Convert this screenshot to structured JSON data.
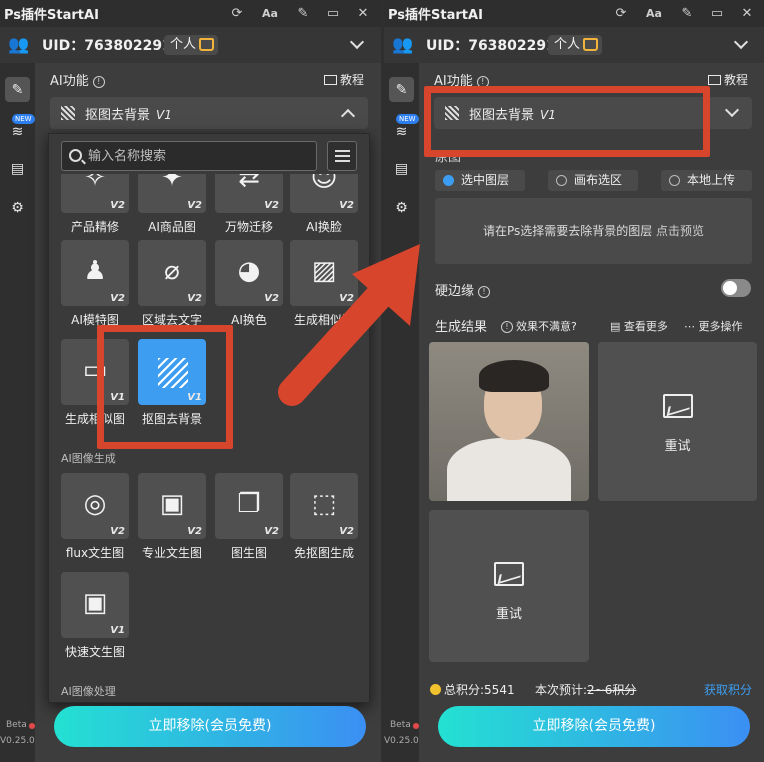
{
  "app": {
    "title": "Ps插件StartAI"
  },
  "account": {
    "uid_label": "UID：763802291",
    "plan": "个人"
  },
  "ai_section": {
    "title": "AI功能",
    "tutorial": "教程"
  },
  "selected_feature": {
    "name": "抠图去背景",
    "version": "V1"
  },
  "search": {
    "placeholder": "输入名称搜索"
  },
  "groups": {
    "generate": "AI图像生成",
    "process": "AI图像处理"
  },
  "feature_grid": [
    {
      "name": "产品精修",
      "version": "V2",
      "icon": "brush-icon"
    },
    {
      "name": "AI商品图",
      "version": "V2",
      "icon": "magic-wand-icon"
    },
    {
      "name": "万物迁移",
      "version": "V2",
      "icon": "transfer-icon"
    },
    {
      "name": "AI换脸",
      "version": "V2",
      "icon": "face-icon"
    },
    {
      "name": "AI模特图",
      "version": "V2",
      "icon": "model-icon"
    },
    {
      "name": "区域去文字",
      "version": "V2",
      "icon": "erase-icon"
    },
    {
      "name": "AI换色",
      "version": "V2",
      "icon": "palette-icon"
    },
    {
      "name": "生成相似图",
      "version": "V2",
      "icon": "image-sparkle-icon"
    },
    {
      "name": "生成相似图",
      "version": "V1",
      "icon": "image-icon"
    },
    {
      "name": "抠图去背景",
      "version": "V1",
      "icon": "cutout-icon"
    }
  ],
  "generate_grid": [
    {
      "name": "flux文生图",
      "version": "V2",
      "icon": "swirl-icon"
    },
    {
      "name": "专业文生图",
      "version": "V2",
      "icon": "text-image-icon"
    },
    {
      "name": "图生图",
      "version": "V2",
      "icon": "image-to-image-icon"
    },
    {
      "name": "免抠图生成",
      "version": "V2",
      "icon": "no-cutout-icon"
    },
    {
      "name": "快速文生图",
      "version": "V1",
      "icon": "quick-text-image-icon"
    }
  ],
  "source": {
    "label": "原图",
    "options": [
      "选中图层",
      "画布选区",
      "本地上传"
    ],
    "selected": "选中图层",
    "hint": "请在Ps选择需要去除背景的图层",
    "hint_link": "点击预览"
  },
  "hard_edge": {
    "label": "硬边缘",
    "on": false
  },
  "results": {
    "title": "生成结果",
    "unsatisfied": "效果不满意?",
    "view_more": "查看更多",
    "more_actions": "更多操作",
    "retry": "重试"
  },
  "footer": {
    "total_points": "总积分:5541",
    "estimate_label": "本次预计:",
    "estimate_value": "2~6积分",
    "get_points": "获取积分",
    "cta": "立即移除(会员免费)",
    "beta": "Beta",
    "version": "V0.25.0"
  },
  "sidebar": {
    "new_badge": "NEW"
  },
  "colors": {
    "accent": "#3d9df0",
    "highlight": "#d7452c",
    "cta_start": "#23e1d2",
    "cta_end": "#3b8ff3"
  }
}
